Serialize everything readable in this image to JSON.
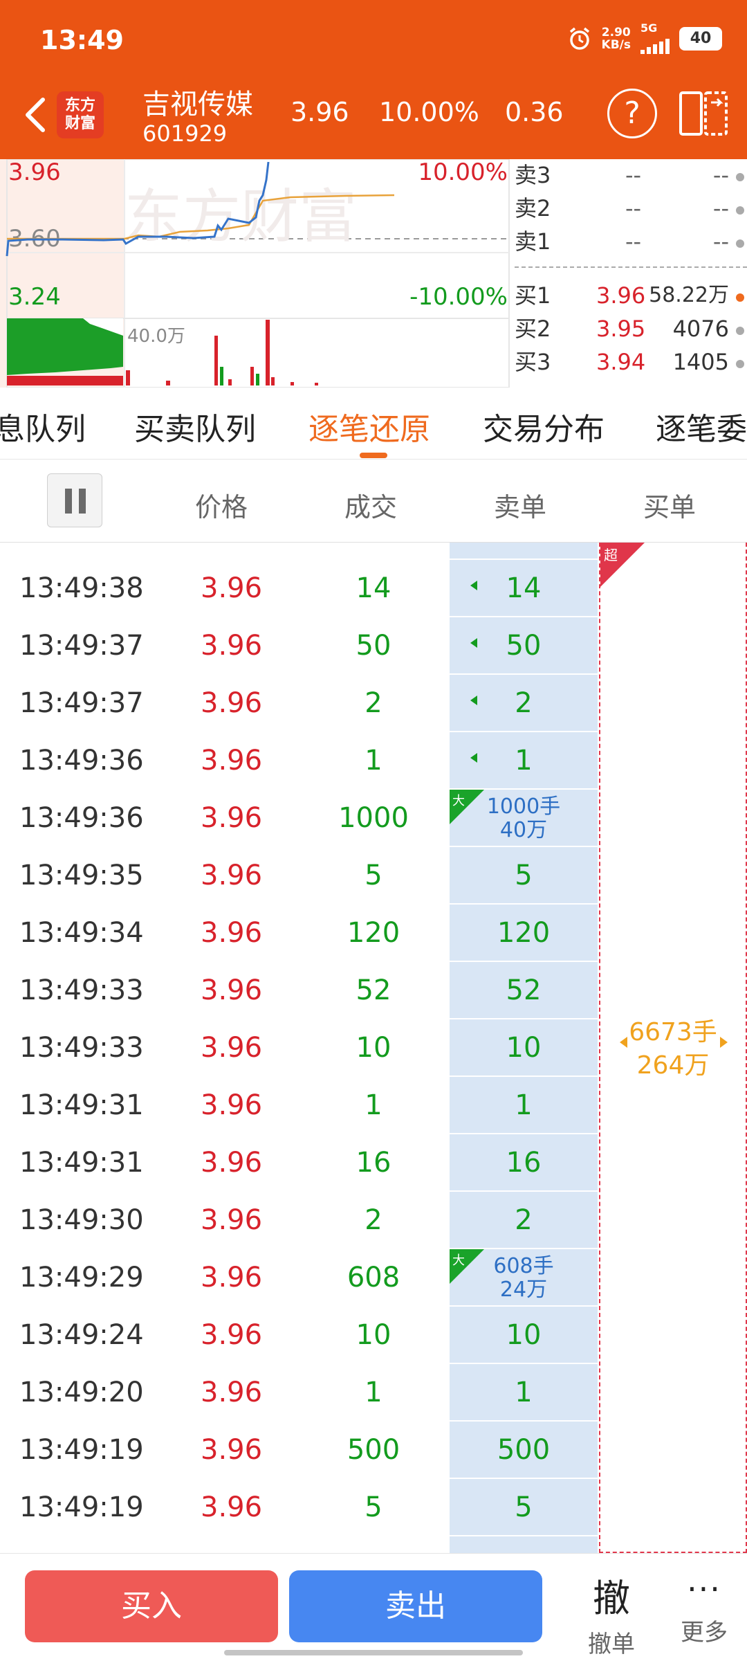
{
  "status_bar": {
    "time": "13:49",
    "net_speed_top": "2.90",
    "net_speed_bottom": "KB/s",
    "network": "5G",
    "battery": "40"
  },
  "header": {
    "logo_line1": "东方",
    "logo_line2": "财富",
    "stock_name": "吉视传媒",
    "stock_code": "601929",
    "price": "3.96",
    "change_pct": "10.00%",
    "change_amt": "0.36",
    "help": "?"
  },
  "chart": {
    "price_top": "3.96",
    "price_mid": "3.60",
    "price_bottom": "3.24",
    "pct_top": "10.00%",
    "pct_bottom": "-10.00%",
    "volume_label": "40.0万",
    "watermark": "东方财富"
  },
  "order_book": {
    "asks": [
      {
        "label": "卖3",
        "price": "--",
        "vol": "--"
      },
      {
        "label": "卖2",
        "price": "--",
        "vol": "--"
      },
      {
        "label": "卖1",
        "price": "--",
        "vol": "--"
      }
    ],
    "bids": [
      {
        "label": "买1",
        "price": "3.96",
        "vol": "58.22万"
      },
      {
        "label": "买2",
        "price": "3.95",
        "vol": "4076"
      },
      {
        "label": "买3",
        "price": "3.94",
        "vol": "1405"
      }
    ]
  },
  "tabs": [
    "息队列",
    "买卖队列",
    "逐笔还原",
    "交易分布",
    "逐笔委"
  ],
  "columns": {
    "price": "价格",
    "volume": "成交",
    "sell": "卖单",
    "buy": "买单"
  },
  "trades": [
    {
      "time": "13:49:38",
      "price": "3.96",
      "vol": "14",
      "sell": "14",
      "arrow": true
    },
    {
      "time": "13:49:37",
      "price": "3.96",
      "vol": "50",
      "sell": "50",
      "arrow": true
    },
    {
      "time": "13:49:37",
      "price": "3.96",
      "vol": "2",
      "sell": "2",
      "arrow": true
    },
    {
      "time": "13:49:36",
      "price": "3.96",
      "vol": "1",
      "sell": "1",
      "arrow": true
    },
    {
      "time": "13:49:36",
      "price": "3.96",
      "vol": "1000",
      "big_top": "1000手",
      "big_bottom": "40万"
    },
    {
      "time": "13:49:35",
      "price": "3.96",
      "vol": "5",
      "sell": "5"
    },
    {
      "time": "13:49:34",
      "price": "3.96",
      "vol": "120",
      "sell": "120"
    },
    {
      "time": "13:49:33",
      "price": "3.96",
      "vol": "52",
      "sell": "52"
    },
    {
      "time": "13:49:33",
      "price": "3.96",
      "vol": "10",
      "sell": "10"
    },
    {
      "time": "13:49:31",
      "price": "3.96",
      "vol": "1",
      "sell": "1"
    },
    {
      "time": "13:49:31",
      "price": "3.96",
      "vol": "16",
      "sell": "16"
    },
    {
      "time": "13:49:30",
      "price": "3.96",
      "vol": "2",
      "sell": "2"
    },
    {
      "time": "13:49:29",
      "price": "3.96",
      "vol": "608",
      "big_top": "608手",
      "big_bottom": "24万"
    },
    {
      "time": "13:49:24",
      "price": "3.96",
      "vol": "10",
      "sell": "10"
    },
    {
      "time": "13:49:20",
      "price": "3.96",
      "vol": "1",
      "sell": "1"
    },
    {
      "time": "13:49:19",
      "price": "3.96",
      "vol": "500",
      "sell": "500"
    },
    {
      "time": "13:49:19",
      "price": "3.96",
      "vol": "5",
      "sell": "5"
    }
  ],
  "big_tag": "大",
  "buy_order": {
    "tag": "超",
    "line1": "6673手",
    "line2": "264万"
  },
  "actions": {
    "buy": "买入",
    "sell": "卖出",
    "undo_icon": "撤",
    "undo": "撤单",
    "more_icon": "···",
    "more": "更多"
  }
}
